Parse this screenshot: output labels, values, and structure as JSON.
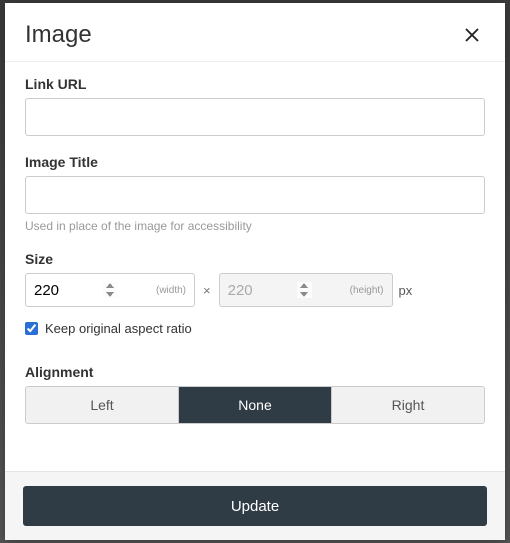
{
  "modal": {
    "title": "Image"
  },
  "link_url": {
    "label": "Link URL",
    "value": ""
  },
  "image_title": {
    "label": "Image Title",
    "value": "",
    "helper": "Used in place of the image for accessibility"
  },
  "size": {
    "label": "Size",
    "width_value": "220",
    "width_hint": "(width)",
    "height_value": "220",
    "height_hint": "(height)",
    "times": "×",
    "unit": "px"
  },
  "aspect": {
    "label": "Keep original aspect ratio",
    "checked": true
  },
  "alignment": {
    "label": "Alignment",
    "options": [
      "Left",
      "None",
      "Right"
    ],
    "selected": "None"
  },
  "footer": {
    "submit": "Update"
  }
}
